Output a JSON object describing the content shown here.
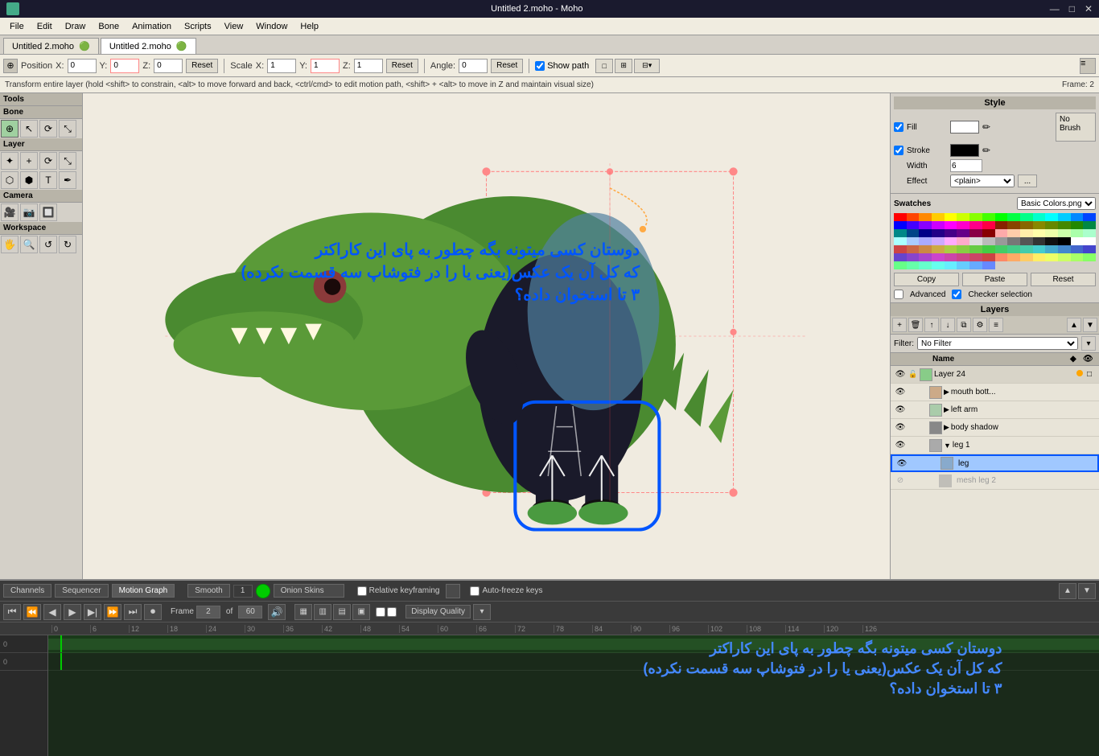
{
  "titlebar": {
    "title": "Untitled 2.moho - Moho",
    "minimize": "—",
    "maximize": "□",
    "close": "✕"
  },
  "menubar": {
    "items": [
      "File",
      "Edit",
      "Draw",
      "Bone",
      "Animation",
      "Scripts",
      "View",
      "Window",
      "Help"
    ]
  },
  "tabs": [
    {
      "label": "Untitled 2.moho",
      "dot": "●",
      "active": false
    },
    {
      "label": "Untitled 2.moho",
      "dot": "●",
      "active": true
    }
  ],
  "toolbar": {
    "position_label": "Position",
    "x_label": "X:",
    "x_value": "0",
    "y_label": "Y:",
    "y_value": "0",
    "z_label": "Z:",
    "z_value": "0",
    "reset_label": "Reset",
    "scale_label": "Scale",
    "sx_label": "X:",
    "sx_value": "1",
    "sy_label": "Y:",
    "sy_value": "1",
    "sz_label": "Z:",
    "sz_value": "1",
    "reset2_label": "Reset",
    "angle_label": "Angle:",
    "angle_value": "0",
    "reset3_label": "Reset",
    "show_path_label": "Show path"
  },
  "statusbar": {
    "text": "Transform entire layer (hold <shift> to constrain, <alt> to move forward and back, <ctrl/cmd> to edit motion path, <shift> + <alt> to move in Z and maintain visual size)",
    "frame_label": "Frame: 2"
  },
  "left_toolbar": {
    "tools_label": "Tools",
    "bone_label": "Bone",
    "layer_label": "Layer",
    "camera_label": "Camera",
    "workspace_label": "Workspace",
    "tools": [
      "⊕",
      "↖",
      "⟳",
      "⤡",
      "✦",
      "✏",
      "⬡",
      "⬢",
      "➤",
      "⌫",
      "T",
      "✒",
      "🎥",
      "📷",
      "🔲",
      "🖐",
      "🔍",
      "↺",
      "↻"
    ]
  },
  "style_panel": {
    "title": "Style",
    "fill_label": "Fill",
    "stroke_label": "Stroke",
    "width_label": "Width",
    "width_value": "6",
    "effect_label": "Effect",
    "effect_value": "<plain>",
    "no_brush_label": "No\nBrush"
  },
  "swatches_panel": {
    "label": "Swatches",
    "select_value": "Basic Colors.png",
    "copy_label": "Copy",
    "paste_label": "Paste",
    "reset_label": "Reset",
    "advanced_label": "Advanced",
    "checker_label": "Checker selection"
  },
  "layers_panel": {
    "title": "Layers",
    "filter_label": "No Filter",
    "name_col": "Name",
    "layers": [
      {
        "name": "Layer 24",
        "level": 0,
        "has_folder": false,
        "selected": false,
        "eye": true,
        "dot_color": "orange"
      },
      {
        "name": "mouth bott...",
        "level": 1,
        "has_folder": true,
        "selected": false,
        "eye": true
      },
      {
        "name": "left arm",
        "level": 1,
        "has_folder": true,
        "selected": false,
        "eye": true
      },
      {
        "name": "body shadow",
        "level": 1,
        "has_folder": true,
        "selected": false,
        "eye": true
      },
      {
        "name": "leg 1",
        "level": 1,
        "has_folder": true,
        "selected": false,
        "eye": true,
        "expanded": true
      },
      {
        "name": "leg",
        "level": 2,
        "has_folder": false,
        "selected": true,
        "eye": true
      },
      {
        "name": "mesh leg 2",
        "level": 2,
        "has_folder": false,
        "selected": false,
        "eye": false
      }
    ]
  },
  "timeline": {
    "channels_label": "Channels",
    "sequencer_label": "Sequencer",
    "motion_graph_label": "Motion Graph",
    "smooth_label": "Smooth",
    "onion_label": "Onion Skins",
    "onion_btn_label": "Onion",
    "smooth_btn_label": "Smooth",
    "relative_kf_label": "Relative keyframing",
    "auto_freeze_label": "Auto-freeze keys",
    "frame_label": "Frame",
    "frame_value": "2",
    "of_label": "of",
    "total_frames": "60",
    "playback_btns": [
      "⏮",
      "⏪",
      "⏴",
      "▶",
      "⏵",
      "⏩",
      "⏭",
      "⏺"
    ],
    "ruler_marks": [
      "0",
      "6",
      "12",
      "18",
      "24",
      "30",
      "36",
      "42",
      "48",
      "54",
      "60",
      "66",
      "72",
      "78",
      "84",
      "90",
      "96",
      "102",
      "108",
      "114",
      "120",
      "126+"
    ],
    "quality_label": "Display Quality"
  },
  "annotation": {
    "line1": "دوستان کسی میتونه بگه چطور به پای این کاراکتر",
    "line2": "که کل آن یک عکس(یعنی یا را در فتوشاپ سه قسمت نکرده)",
    "line3": "۳ تا استخوان داده؟"
  },
  "colors": {
    "accent_blue": "#316ac5",
    "bg_dark": "#2a2a2a",
    "bg_medium": "#d4d0c8",
    "bg_light": "#f0ece0",
    "timeline_green": "#2a4a2a",
    "selected_layer": "#a0c8ff"
  },
  "swatches_colors": [
    "#ff0000",
    "#ff4400",
    "#ff8800",
    "#ffcc00",
    "#ffff00",
    "#ccff00",
    "#88ff00",
    "#44ff00",
    "#00ff00",
    "#00ff44",
    "#00ff88",
    "#00ffcc",
    "#00ffff",
    "#00ccff",
    "#0088ff",
    "#0044ff",
    "#0000ff",
    "#4400ff",
    "#8800ff",
    "#cc00ff",
    "#ff00ff",
    "#ff00cc",
    "#ff0088",
    "#ff0044",
    "#882200",
    "#884400",
    "#886600",
    "#888800",
    "#668800",
    "#448800",
    "#228800",
    "#008844",
    "#008888",
    "#004488",
    "#000088",
    "#220088",
    "#440088",
    "#660088",
    "#880044",
    "#880000",
    "#ffaaaa",
    "#ffccaa",
    "#ffeeaa",
    "#ffffaa",
    "#eeffaa",
    "#ccffaa",
    "#aaffaa",
    "#aaffcc",
    "#aaffff",
    "#aaccff",
    "#aaaaff",
    "#ccaaff",
    "#ffaaff",
    "#ffaacc",
    "#dddddd",
    "#bbbbbb",
    "#999999",
    "#777777",
    "#555555",
    "#333333",
    "#111111",
    "#000000",
    "#ffffff",
    "#ffffff",
    "#cc4444",
    "#cc6644",
    "#cc8844",
    "#ccaa44",
    "#aacc44",
    "#88cc44",
    "#66cc44",
    "#44cc44",
    "#44cc66",
    "#44cc88",
    "#44ccaa",
    "#44cccc",
    "#44aacc",
    "#4488cc",
    "#4466cc",
    "#4444cc",
    "#6644cc",
    "#8844cc",
    "#aa44cc",
    "#cc44cc",
    "#cc44aa",
    "#cc4488",
    "#cc4466",
    "#cc4444",
    "#ff8866",
    "#ffaa66",
    "#ffcc66",
    "#ffee66",
    "#eeff66",
    "#ccff66",
    "#aaff66",
    "#88ff66",
    "#66ff88",
    "#66ffaa",
    "#66ffcc",
    "#66ffee",
    "#66eeff",
    "#66ccff",
    "#66aaff",
    "#6688ff"
  ]
}
